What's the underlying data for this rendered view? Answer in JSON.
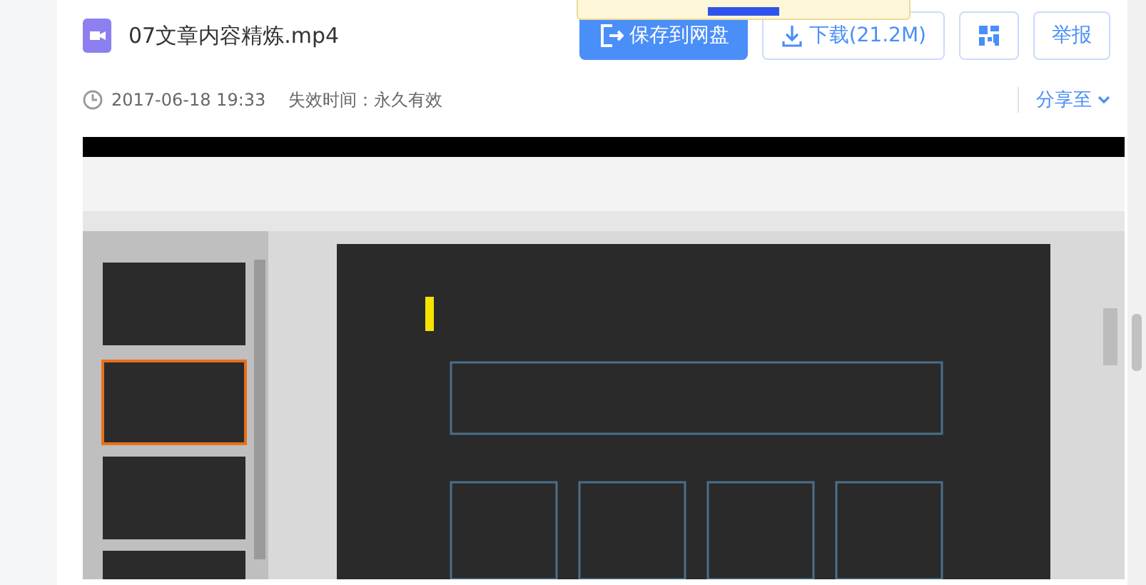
{
  "file": {
    "name": "07文章内容精炼.mp4",
    "date": "2017-06-18 19:33",
    "expiry": "失效时间：永久有效"
  },
  "actions": [
    {
      "kind": "save",
      "label": "保存到网盘"
    },
    {
      "kind": "download",
      "label": "下载(21.2M)"
    },
    {
      "kind": "qr"
    },
    {
      "kind": "report",
      "label": "举报"
    }
  ],
  "share": {
    "label": "分享至"
  }
}
